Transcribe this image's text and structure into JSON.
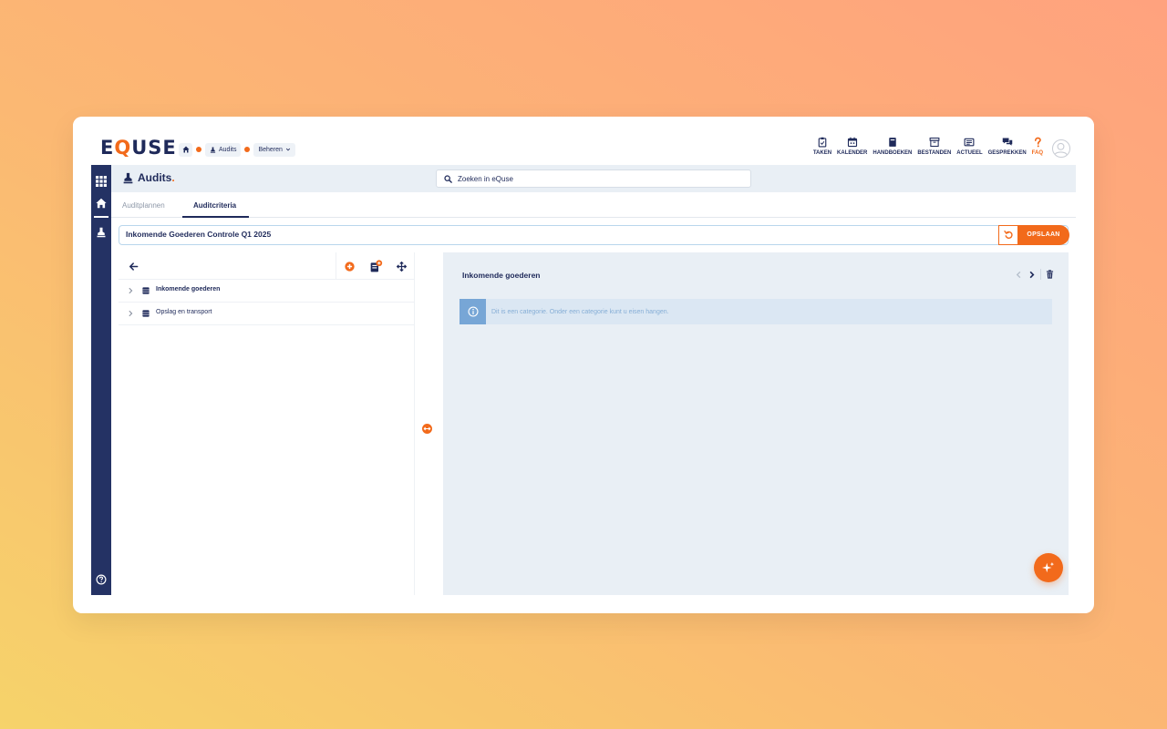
{
  "app": {
    "logo_pre": "E",
    "logo_q": "Q",
    "logo_post": "USE"
  },
  "breadcrumb": {
    "audits": "Audits",
    "beheren": "Beheren"
  },
  "topnav": [
    {
      "label": "TAKEN",
      "icon": "clipboard-icon"
    },
    {
      "label": "KALENDER",
      "icon": "calendar-icon"
    },
    {
      "label": "HANDBOEKEN",
      "icon": "book-icon"
    },
    {
      "label": "BESTANDEN",
      "icon": "archive-icon"
    },
    {
      "label": "ACTUEEL",
      "icon": "newspaper-icon"
    },
    {
      "label": "GESPREKKEN",
      "icon": "chat-icon"
    },
    {
      "label": "FAQ",
      "icon": "question-icon"
    }
  ],
  "header": {
    "title": "Audits",
    "title_dot": "."
  },
  "search": {
    "placeholder": "Zoeken in eQuse"
  },
  "tabs": [
    {
      "label": "Auditplannen"
    },
    {
      "label": "Auditcriteria"
    }
  ],
  "name_field": {
    "value": "Inkomende Goederen Controle Q1 2025"
  },
  "save_label": "OPSLAAN",
  "tree": [
    {
      "label": "Inkomende goederen"
    },
    {
      "label": "Opslag en transport"
    }
  ],
  "detail": {
    "title": "Inkomende goederen",
    "info": "Dit is een categorie. Onder een categorie kunt u eisen hangen."
  },
  "colors": {
    "accent": "#f26a1b",
    "navy": "#1f2a5a",
    "sidebar": "#243264",
    "panel": "#e9eff5"
  }
}
